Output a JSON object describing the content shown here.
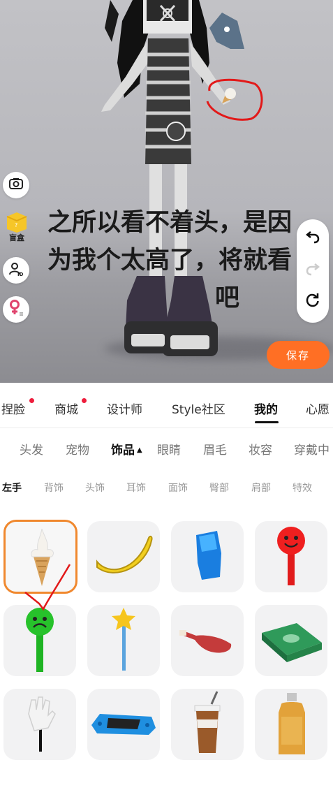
{
  "viewport": {
    "caption": {
      "line1": "之所以看不着头，是因",
      "line2": "为我个太高了，将就看",
      "line3": "吧"
    },
    "blindbox_label": "盲盒",
    "save_label": "保存",
    "colors": {
      "accent": "#ff6f24",
      "badge": "#ee1d3c",
      "selected_border": "#f0882e"
    }
  },
  "main_tabs": [
    {
      "label": "捏脸",
      "has_dot": true
    },
    {
      "label": "商城",
      "has_dot": true
    },
    {
      "label": "设计师"
    },
    {
      "label": "Style社区"
    },
    {
      "label": "我的",
      "active": true
    },
    {
      "label": "心愿"
    }
  ],
  "category_tabs": [
    {
      "label": "头发"
    },
    {
      "label": "宠物"
    },
    {
      "label": "饰品",
      "active": true,
      "caret": "▲"
    },
    {
      "label": "眼睛"
    },
    {
      "label": "眉毛"
    },
    {
      "label": "妆容"
    },
    {
      "label": "穿戴中"
    }
  ],
  "sub_tabs": [
    {
      "label": "左手",
      "active": true
    },
    {
      "label": "背饰"
    },
    {
      "label": "头饰"
    },
    {
      "label": "耳饰"
    },
    {
      "label": "面饰"
    },
    {
      "label": "臀部"
    },
    {
      "label": "肩部"
    },
    {
      "label": "特效"
    }
  ],
  "items": [
    {
      "icon": "ice-cream-cone",
      "selected": true
    },
    {
      "icon": "banana"
    },
    {
      "icon": "blue-glove"
    },
    {
      "icon": "red-smiley-sign"
    },
    {
      "icon": "green-sad-sign"
    },
    {
      "icon": "star-wand"
    },
    {
      "icon": "meat-steak"
    },
    {
      "icon": "cash-stack"
    },
    {
      "icon": "white-glove-hand"
    },
    {
      "icon": "game-console"
    },
    {
      "icon": "coffee-cup"
    },
    {
      "icon": "juice-bottle"
    }
  ]
}
